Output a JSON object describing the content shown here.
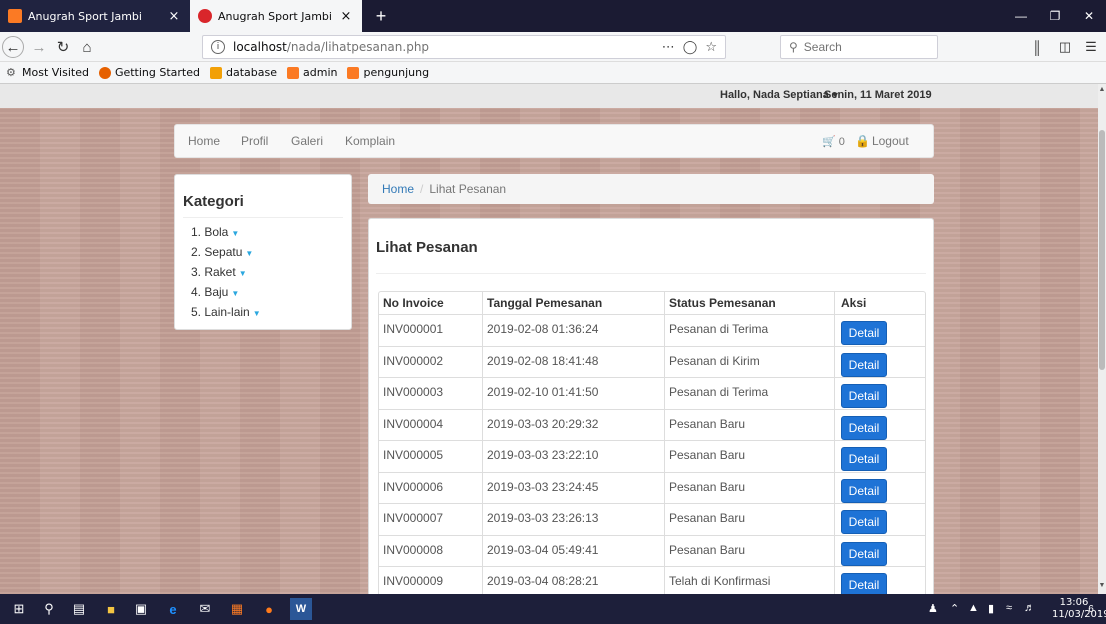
{
  "browser": {
    "tabs": [
      {
        "title": "Anugrah Sport Jambi",
        "active": false
      },
      {
        "title": "Anugrah Sport Jambi",
        "active": true
      }
    ],
    "new_tab": "+",
    "close_glyph": "×",
    "url_host": "localhost",
    "url_path": "/nada/lihatpesanan.php",
    "search_placeholder": "Search",
    "bookmarks": [
      "Most Visited",
      "Getting Started",
      "database",
      "admin",
      "pengunjung"
    ]
  },
  "topbar": {
    "greeting": "Hallo, Nada Septiana",
    "date": "Senin, 11 Maret 2019"
  },
  "nav": {
    "items": [
      "Home",
      "Profil",
      "Galeri",
      "Komplain"
    ],
    "cart_count": "0",
    "logout": "Logout"
  },
  "sidebar": {
    "title": "Kategori",
    "categories": [
      "1. Bola",
      "2. Sepatu",
      "3. Raket",
      "4. Baju",
      "5. Lain-lain"
    ]
  },
  "breadcrumb": {
    "home": "Home",
    "separator": "/",
    "current": "Lihat Pesanan"
  },
  "content": {
    "title": "Lihat Pesanan",
    "columns": [
      "No Invoice",
      "Tanggal Pemesanan",
      "Status Pemesanan",
      "Aksi"
    ],
    "orders": [
      {
        "invoice": "INV000001",
        "date": "2019-02-08 01:36:24",
        "status": "Pesanan di Terima",
        "action": "Detail"
      },
      {
        "invoice": "INV000002",
        "date": "2019-02-08 18:41:48",
        "status": "Pesanan di Kirim",
        "action": "Detail"
      },
      {
        "invoice": "INV000003",
        "date": "2019-02-10 01:41:50",
        "status": "Pesanan di Terima",
        "action": "Detail"
      },
      {
        "invoice": "INV000004",
        "date": "2019-03-03 20:29:32",
        "status": "Pesanan Baru",
        "action": "Detail"
      },
      {
        "invoice": "INV000005",
        "date": "2019-03-03 23:22:10",
        "status": "Pesanan Baru",
        "action": "Detail"
      },
      {
        "invoice": "INV000006",
        "date": "2019-03-03 23:24:45",
        "status": "Pesanan Baru",
        "action": "Detail"
      },
      {
        "invoice": "INV000007",
        "date": "2019-03-03 23:26:13",
        "status": "Pesanan Baru",
        "action": "Detail"
      },
      {
        "invoice": "INV000008",
        "date": "2019-03-04 05:49:41",
        "status": "Pesanan Baru",
        "action": "Detail"
      },
      {
        "invoice": "INV000009",
        "date": "2019-03-04 08:28:21",
        "status": "Telah di Konfirmasi",
        "action": "Detail"
      }
    ]
  },
  "taskbar": {
    "time": "13:06",
    "date": "11/03/2019",
    "notification_count": "6"
  },
  "colors": {
    "accent": "#1e73d6",
    "link": "#337ab7",
    "caret": "#2aa7df"
  }
}
